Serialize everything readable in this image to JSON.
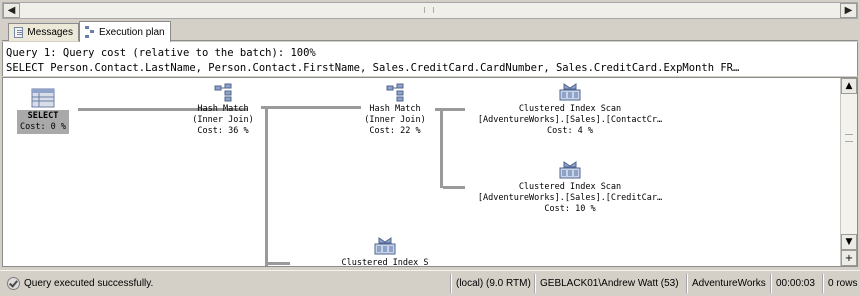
{
  "tabs": [
    {
      "label": "Messages",
      "icon": "messages-icon"
    },
    {
      "label": "Execution plan",
      "icon": "execution-plan-icon"
    }
  ],
  "query": {
    "cost_line": "Query 1: Query cost (relative to the batch): 100%",
    "sql_line": "SELECT Person.Contact.LastName, Person.Contact.FirstName, Sales.CreditCard.CardNumber, Sales.CreditCard.ExpMonth FR…"
  },
  "plan": {
    "select": {
      "name": "SELECT",
      "cost": "Cost: 0 %"
    },
    "hash1": {
      "name": "Hash Match",
      "sub": "(Inner Join)",
      "cost": "Cost: 36 %"
    },
    "hash2": {
      "name": "Hash Match",
      "sub": "(Inner Join)",
      "cost": "Cost: 22 %"
    },
    "scan1": {
      "name": "Clustered Index Scan",
      "object": "[AdventureWorks].[Sales].[ContactCr…",
      "cost": "Cost: 4 %"
    },
    "scan2": {
      "name": "Clustered Index Scan",
      "object": "[AdventureWorks].[Sales].[CreditCar…",
      "cost": "Cost: 10 %"
    },
    "scan3": {
      "name": "Clustered Index S"
    }
  },
  "status": {
    "message": "Query executed successfully.",
    "server": "(local) (9.0 RTM)",
    "user": "GEBLACK01\\Andrew Watt (53)",
    "database": "AdventureWorks",
    "elapsed": "00:00:03",
    "rows": "0 rows"
  },
  "colors": {
    "panel": "#d4d0c8",
    "plan_bg": "#ffffff",
    "select_highlight": "#a9a9a9"
  }
}
